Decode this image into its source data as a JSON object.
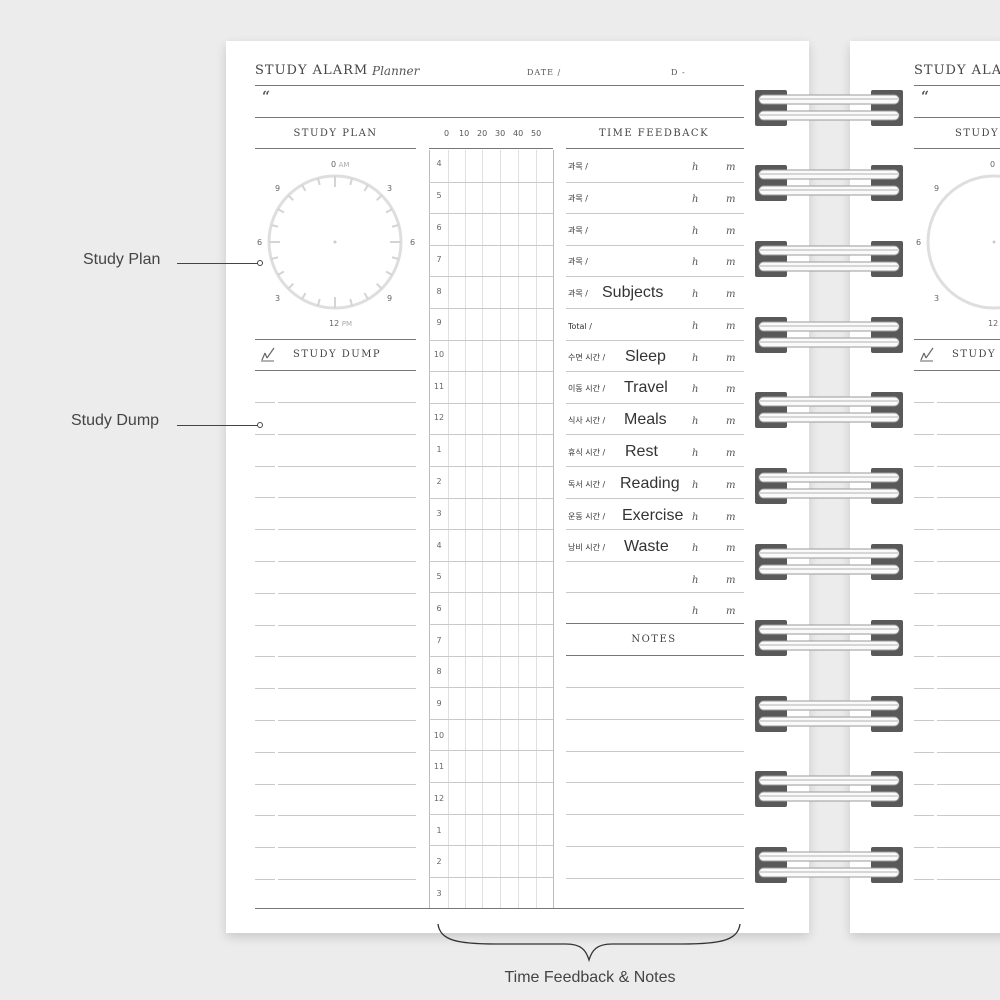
{
  "header": {
    "title": "STUDY ALARM",
    "script": "Planner",
    "date_label": "DATE /",
    "dday_label": "D -",
    "quote_mark": "“"
  },
  "sections": {
    "study_plan": "STUDY PLAN",
    "study_dump": "STUDY DUMP",
    "time_feedback": "TIME FEEDBACK",
    "notes": "NOTES"
  },
  "clock": {
    "top": "0",
    "top_sub": "AM",
    "bottom": "12",
    "bottom_sub": "PM",
    "labels": [
      "9",
      "3",
      "6",
      "6",
      "3",
      "9"
    ]
  },
  "minutes": [
    "0",
    "10",
    "20",
    "30",
    "40",
    "50"
  ],
  "hours": [
    "4",
    "5",
    "6",
    "7",
    "8",
    "9",
    "10",
    "11",
    "12",
    "1",
    "2",
    "3",
    "4",
    "5",
    "6",
    "7",
    "8",
    "9",
    "10",
    "11",
    "12",
    "1",
    "2",
    "3"
  ],
  "feedback": [
    {
      "small": "과목 /",
      "big": "",
      "h": "h",
      "m": "m"
    },
    {
      "small": "과목 /",
      "big": "",
      "h": "h",
      "m": "m"
    },
    {
      "small": "과목 /",
      "big": "",
      "h": "h",
      "m": "m"
    },
    {
      "small": "과목 /",
      "big": "",
      "h": "h",
      "m": "m"
    },
    {
      "small": "과목 /",
      "big": "Subjects",
      "h": "h",
      "m": "m"
    },
    {
      "small": "Total /",
      "big": "",
      "h": "h",
      "m": "m"
    },
    {
      "small": "수면 시간 /",
      "big": "Sleep",
      "h": "h",
      "m": "m"
    },
    {
      "small": "이동 시간 /",
      "big": "Travel",
      "h": "h",
      "m": "m"
    },
    {
      "small": "식사 시간 /",
      "big": "Meals",
      "h": "h",
      "m": "m"
    },
    {
      "small": "휴식 시간 /",
      "big": "Rest",
      "h": "h",
      "m": "m"
    },
    {
      "small": "독서 시간 /",
      "big": "Reading",
      "h": "h",
      "m": "m"
    },
    {
      "small": "운동 시간 /",
      "big": "Exercise",
      "h": "h",
      "m": "m"
    },
    {
      "small": "낭비 시간 /",
      "big": "Waste",
      "h": "h",
      "m": "m"
    },
    {
      "small": "",
      "big": "",
      "h": "h",
      "m": "m"
    },
    {
      "small": "",
      "big": "",
      "h": "h",
      "m": "m"
    }
  ],
  "callouts": {
    "study_plan": "Study Plan",
    "study_dump": "Study Dump",
    "time_feedback_notes": "Time Feedback & Notes"
  },
  "colors": {
    "background": "#ececec",
    "page": "#ffffff",
    "ring_clip": "#555555",
    "rule": "#c9c9c9"
  }
}
